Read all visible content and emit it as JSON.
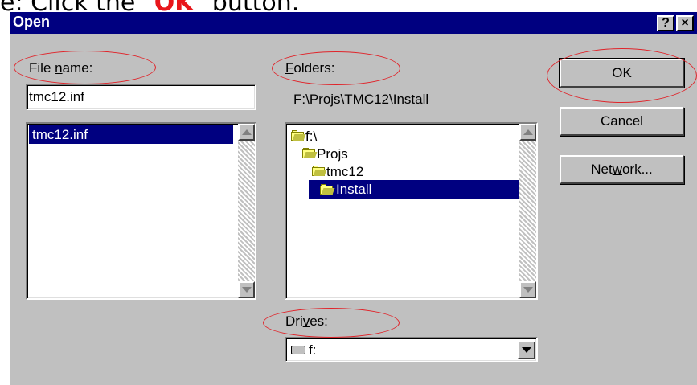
{
  "caption": {
    "prefix": "e: Click the \"",
    "highlight": "OK",
    "suffix": "\" button."
  },
  "window": {
    "title": "Open"
  },
  "titlebar_buttons": {
    "help": "?",
    "close": "×"
  },
  "file_name": {
    "label_before": "File ",
    "label_hotkey": "n",
    "label_after": "ame:",
    "value": "tmc12.inf",
    "list": [
      "tmc12.inf"
    ]
  },
  "folders": {
    "label_hotkey": "F",
    "label_after": "olders:",
    "path": "F:\\Projs\\TMC12\\Install",
    "tree": [
      {
        "name": "f:\\",
        "icon": "open-folder-icon",
        "selected": false
      },
      {
        "name": "Projs",
        "icon": "open-folder-icon",
        "selected": false
      },
      {
        "name": "tmc12",
        "icon": "open-folder-icon",
        "selected": false
      },
      {
        "name": "Install",
        "icon": "open-folder-icon",
        "selected": true
      }
    ]
  },
  "drives": {
    "label_before": "Dri",
    "label_hotkey": "v",
    "label_after": "es:",
    "value": "f:",
    "icon": "drive-icon"
  },
  "buttons": {
    "ok": "OK",
    "cancel": "Cancel",
    "network_before": "Net",
    "network_hotkey": "w",
    "network_after": "ork..."
  },
  "colors": {
    "titlebar": "#000080",
    "selection": "#000080",
    "dialog_bg": "#c0c0c0",
    "annotation": "#e0242a",
    "caption_highlight": "#e8161b"
  }
}
